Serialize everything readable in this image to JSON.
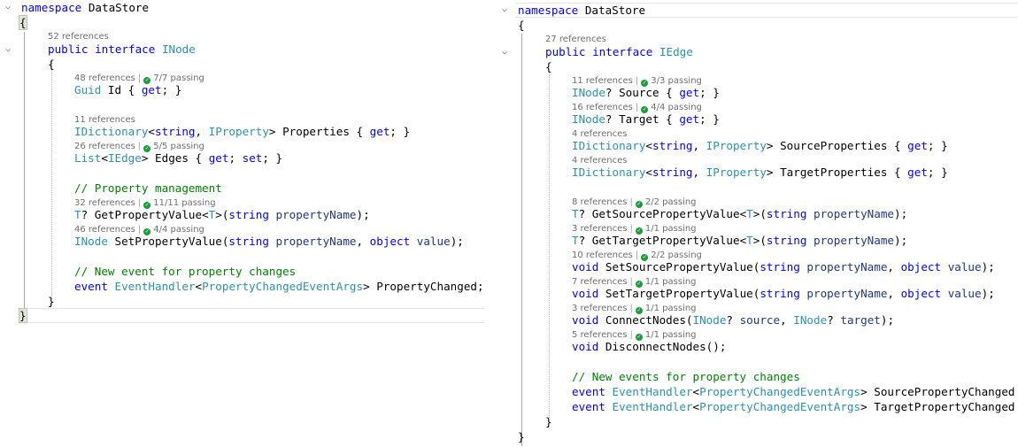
{
  "left": {
    "ns_kw": "namespace",
    "ns_name": "DataStore",
    "open_brace": "{",
    "close_brace": "}",
    "interface_refs": "52 references",
    "iface_kw1": "public",
    "iface_kw2": "interface",
    "iface_name": "INode",
    "iface_open": "{",
    "iface_close": "}",
    "members": {
      "id": {
        "refs": "48 references",
        "pass": "7/7 passing",
        "t1": "Guid",
        "t2": " Id { ",
        "k1": "get",
        "t3": "; }"
      },
      "props": {
        "refs": "11 references",
        "t1": "IDictionary",
        "t2": "<",
        "k1": "string",
        "t3": ", ",
        "t4": "IProperty",
        "t5": "> Properties { ",
        "k2": "get",
        "t6": "; }"
      },
      "edges": {
        "refs": "26 references",
        "pass": "5/5 passing",
        "t1": "List",
        "t2": "<",
        "t3": "IEdge",
        "t4": "> Edges { ",
        "k1": "get",
        "t5": "; ",
        "k2": "set",
        "t6": "; }"
      },
      "comment1": "// Property management",
      "getval": {
        "refs": "32 references",
        "pass": "11/11 passing",
        "t1": "T",
        "t2": "? GetPropertyValue<",
        "t3": "T",
        "t4": ">(",
        "k1": "string",
        "t5": " ",
        "p1": "propertyName",
        "t6": ");"
      },
      "setval": {
        "refs": "46 references",
        "pass": "4/4 passing",
        "t1": "INode",
        "t2": " SetPropertyValue(",
        "k1": "string",
        "t3": " ",
        "p1": "propertyName",
        "t4": ", ",
        "k2": "object",
        "t5": " ",
        "p2": "value",
        "t6": ");"
      },
      "comment2": "// New event for property changes",
      "event": {
        "k1": "event",
        "t1": " ",
        "t2": "EventHandler",
        "t3": "<",
        "t4": "PropertyChangedEventArgs",
        "t5": "> PropertyChanged;"
      }
    }
  },
  "right": {
    "ns_kw": "namespace",
    "ns_name": "DataStore",
    "open_brace": "{",
    "close_brace": "}",
    "interface_refs": "27 references",
    "iface_kw1": "public",
    "iface_kw2": "interface",
    "iface_name": "IEdge",
    "iface_open": "{",
    "iface_close": "}",
    "members": {
      "source": {
        "refs": "11 references",
        "pass": "3/3 passing",
        "t1": "INode",
        "t2": "? Source { ",
        "k1": "get",
        "t3": "; }"
      },
      "target": {
        "refs": "16 references",
        "pass": "4/4 passing",
        "t1": "INode",
        "t2": "? Target { ",
        "k1": "get",
        "t3": "; }"
      },
      "srcprops": {
        "refs": "4 references",
        "t1": "IDictionary",
        "t2": "<",
        "k1": "string",
        "t3": ", ",
        "t4": "IProperty",
        "t5": "> SourceProperties { ",
        "k2": "get",
        "t6": "; }"
      },
      "tgtprops": {
        "refs": "4 references",
        "t1": "IDictionary",
        "t2": "<",
        "k1": "string",
        "t3": ", ",
        "t4": "IProperty",
        "t5": "> TargetProperties { ",
        "k2": "get",
        "t6": "; }"
      },
      "getsrc": {
        "refs": "8 references",
        "pass": "2/2 passing",
        "t1": "T",
        "t2": "? GetSourcePropertyValue<",
        "t3": "T",
        "t4": ">(",
        "k1": "string",
        "t5": " ",
        "p1": "propertyName",
        "t6": ");"
      },
      "gettgt": {
        "refs": "3 references",
        "pass": "1/1 passing",
        "t1": "T",
        "t2": "? GetTargetPropertyValue<",
        "t3": "T",
        "t4": ">(",
        "k1": "string",
        "t5": " ",
        "p1": "propertyName",
        "t6": ");"
      },
      "setsrc": {
        "refs": "10 references",
        "pass": "2/2 passing",
        "k0": "void",
        "t1": " SetSourcePropertyValue(",
        "k1": "string",
        "t2": " ",
        "p1": "propertyName",
        "t3": ", ",
        "k2": "object",
        "t4": " ",
        "p2": "value",
        "t5": ");"
      },
      "settgt": {
        "refs": "7 references",
        "pass": "1/1 passing",
        "k0": "void",
        "t1": " SetTargetPropertyValue(",
        "k1": "string",
        "t2": " ",
        "p1": "propertyName",
        "t3": ", ",
        "k2": "object",
        "t4": " ",
        "p2": "value",
        "t5": ");"
      },
      "connect": {
        "refs": "3 references",
        "pass": "1/1 passing",
        "k0": "void",
        "t1": " ConnectNodes(",
        "ty1": "INode",
        "t2": "? ",
        "p1": "source",
        "t3": ", ",
        "ty2": "INode",
        "t4": "? ",
        "p2": "target",
        "t5": ");"
      },
      "disconnect": {
        "refs": "5 references",
        "pass": "1/1 passing",
        "k0": "void",
        "t1": " DisconnectNodes();"
      },
      "comment1": "// New events for property changes",
      "event1": {
        "k1": "event",
        "t1": " ",
        "t2": "EventHandler",
        "t3": "<",
        "t4": "PropertyChangedEventArgs",
        "t5": "> SourcePropertyChanged"
      },
      "event2": {
        "k1": "event",
        "t1": " ",
        "t2": "EventHandler",
        "t3": "<",
        "t4": "PropertyChangedEventArgs",
        "t5": "> TargetPropertyChanged"
      }
    }
  },
  "icons": {
    "fold": "chevron-down-icon",
    "check": "check-circle-icon"
  },
  "colors": {
    "keyword": "#0000ff",
    "type": "#2b91af",
    "comment": "#008000",
    "param": "#1f377f",
    "passing": "#1c9c3a"
  }
}
